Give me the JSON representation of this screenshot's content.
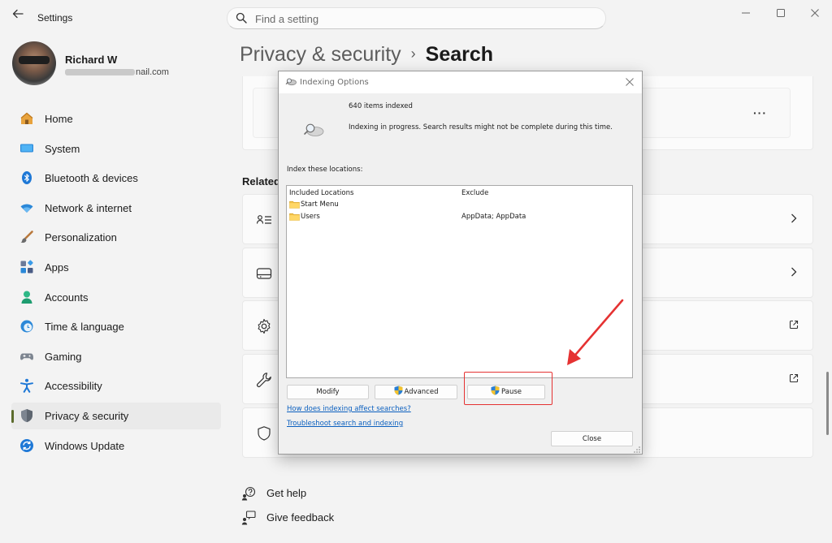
{
  "app": {
    "title": "Settings"
  },
  "search": {
    "placeholder": "Find a setting"
  },
  "user": {
    "name": "Richard W",
    "email_suffix": "nail.com"
  },
  "nav": {
    "items": [
      {
        "label": "Home",
        "icon": "home-icon",
        "active": false
      },
      {
        "label": "System",
        "icon": "system-icon",
        "active": false
      },
      {
        "label": "Bluetooth & devices",
        "icon": "bluetooth-icon",
        "active": false
      },
      {
        "label": "Network & internet",
        "icon": "network-icon",
        "active": false
      },
      {
        "label": "Personalization",
        "icon": "personalization-icon",
        "active": false
      },
      {
        "label": "Apps",
        "icon": "apps-icon",
        "active": false
      },
      {
        "label": "Accounts",
        "icon": "accounts-icon",
        "active": false
      },
      {
        "label": "Time & language",
        "icon": "time-language-icon",
        "active": false
      },
      {
        "label": "Gaming",
        "icon": "gaming-icon",
        "active": false
      },
      {
        "label": "Accessibility",
        "icon": "accessibility-icon",
        "active": false
      },
      {
        "label": "Privacy & security",
        "icon": "privacy-shield-icon",
        "active": true
      },
      {
        "label": "Windows Update",
        "icon": "windows-update-icon",
        "active": false
      }
    ]
  },
  "breadcrumb": {
    "parent": "Privacy & security",
    "separator": "›",
    "current": "Search"
  },
  "related": {
    "title": "Related",
    "rows": [
      {
        "icon": "indexing-list-icon",
        "action": "chevron-right-icon"
      },
      {
        "icon": "drive-icon",
        "action": "chevron-right-icon"
      },
      {
        "icon": "gear-icon",
        "action": "external-link-icon"
      },
      {
        "icon": "wrench-icon",
        "action": "external-link-icon"
      },
      {
        "icon": "shield-outline-icon",
        "action": "none"
      }
    ]
  },
  "more_label": "···",
  "help": {
    "get_help": "Get help",
    "give_feedback": "Give feedback"
  },
  "dialog": {
    "title": "Indexing Options",
    "items_indexed": "640 items indexed",
    "status_message": "Indexing in progress. Search results might not be complete during this time.",
    "locations_label": "Index these locations:",
    "columns": {
      "included": "Included Locations",
      "exclude": "Exclude"
    },
    "locations": [
      {
        "name": "Start Menu",
        "exclude": ""
      },
      {
        "name": "Users",
        "exclude": "AppData; AppData"
      }
    ],
    "buttons": {
      "modify": "Modify",
      "advanced": "Advanced",
      "pause": "Pause",
      "close": "Close"
    },
    "links": {
      "how_affects": "How does indexing affect searches?",
      "troubleshoot": "Troubleshoot search and indexing"
    }
  },
  "colors": {
    "accent": "#5c6b2c",
    "highlight": "#e53232",
    "link": "#0a5fbf"
  }
}
